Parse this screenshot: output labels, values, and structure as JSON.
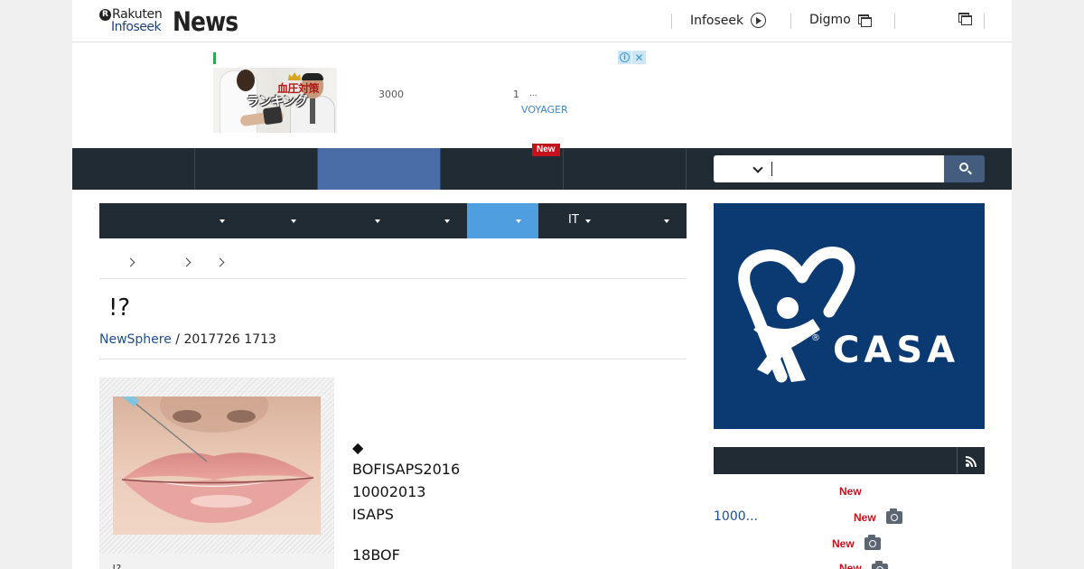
{
  "header": {
    "logo": {
      "rakuten": "Rakuten",
      "infoseek": "Infoseek",
      "news": "News",
      "badge": "R"
    },
    "links": [
      {
        "label": "Infoseek",
        "icon": "circle-arrow-icon"
      },
      {
        "label": "Digmo",
        "icon": "new-window-icon"
      },
      {
        "label": "",
        "icon": "new-window-icon"
      }
    ]
  },
  "ad": {
    "image_text_1": "血圧対策",
    "image_text_2": "ランキング",
    "text_1": "3000",
    "text_2": "1",
    "text_3": "...",
    "sponsor": "VOYAGER",
    "info_icon": "i",
    "close_icon": "✕"
  },
  "nav": {
    "new_badge": "New",
    "search_placeholder": ""
  },
  "categories": [
    {
      "label": ""
    },
    {
      "label": ""
    },
    {
      "label": ""
    },
    {
      "label": ""
    },
    {
      "label": "",
      "active": true
    },
    {
      "label": "IT"
    },
    {
      "label": ""
    }
  ],
  "article": {
    "title": "!?",
    "source": "NewSphere",
    "date": " / 2017726 1713",
    "caption": "!?",
    "paragraphs": [
      "◆",
      "BOFISAPS2016",
      "10002013",
      "ISAPS",
      "18BOF"
    ]
  },
  "sidebar": {
    "ad_brand": "CASA",
    "ad_reg": "®",
    "ranking": [
      {
        "new": "New",
        "text": "",
        "camera": false
      },
      {
        "new": "New",
        "text": "1000...",
        "camera": true
      },
      {
        "new": "New",
        "text": "",
        "camera": true
      },
      {
        "new": "New",
        "text": "",
        "camera": true
      }
    ]
  },
  "colors": {
    "nav_dark": "#202b33",
    "nav_active": "#4a6da7",
    "category_active": "#4f9ee0",
    "new_red": "#c4121c",
    "link_blue": "#1e4f8c",
    "casa_blue": "#0b3a73"
  }
}
